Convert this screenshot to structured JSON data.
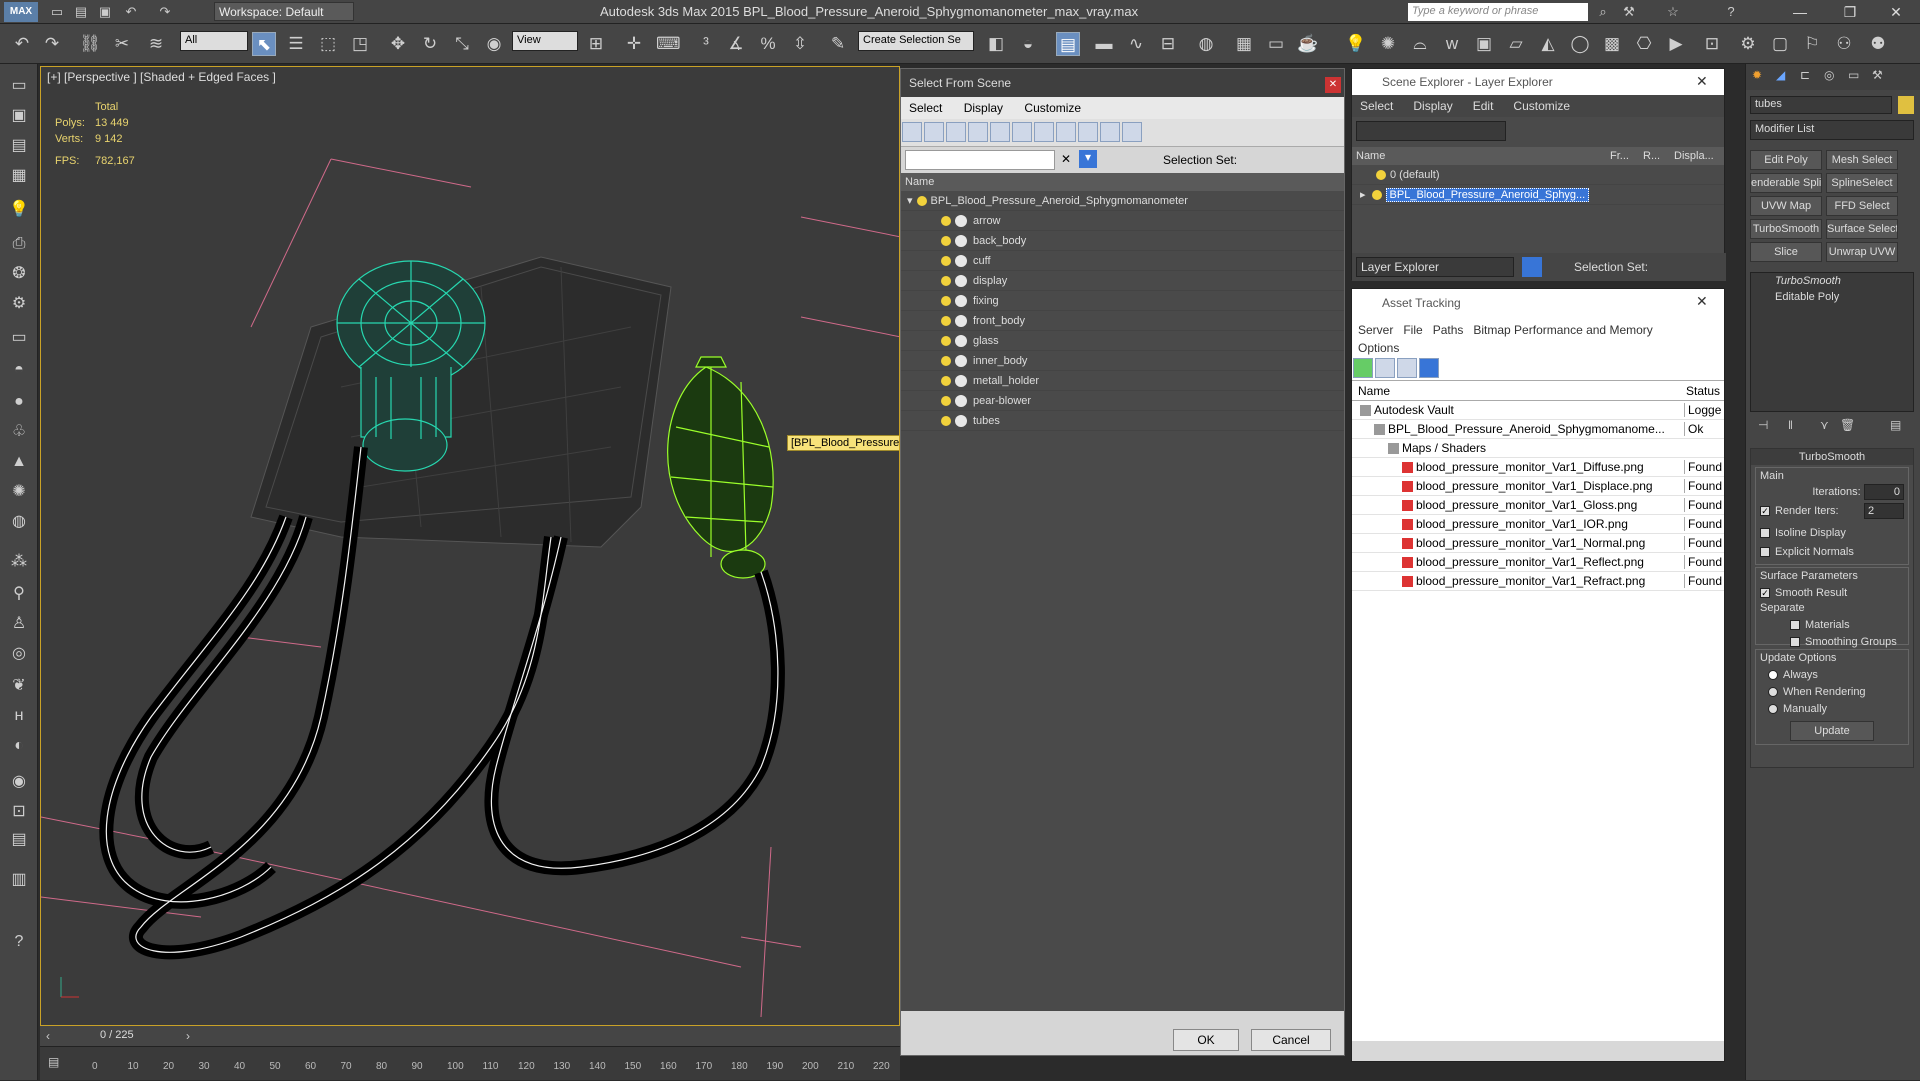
{
  "app": {
    "title": "Autodesk 3ds Max  2015     BPL_Blood_Pressure_Aneroid_Sphygmomanometer_max_vray.max",
    "workspace": "Workspace: Default",
    "search_placeholder": "Type a keyword or phrase"
  },
  "toolbar": {
    "selection_filter": "All",
    "ref_coord": "View",
    "named_selection": "Create Selection Se"
  },
  "viewport": {
    "label": "[+] [Perspective ] [Shaded + Edged Faces ]",
    "stats_total": "Total",
    "polys_label": "Polys:",
    "polys_value": "13 449",
    "verts_label": "Verts:",
    "verts_value": "9 142",
    "fps_label": "FPS:",
    "fps_value": "782,167",
    "object_tooltip": "[BPL_Blood_Pressure"
  },
  "timeline": {
    "frame": "0 / 225",
    "ticks": [
      "0",
      "10",
      "20",
      "30",
      "40",
      "50",
      "60",
      "70",
      "80",
      "90",
      "100",
      "110",
      "120",
      "130",
      "140",
      "150",
      "160",
      "170",
      "180",
      "190",
      "200",
      "210",
      "220"
    ]
  },
  "select_from_scene": {
    "title": "Select From Scene",
    "menu": [
      "Select",
      "Display",
      "Customize"
    ],
    "selection_set_label": "Selection Set:",
    "column_name": "Name",
    "root": "BPL_Blood_Pressure_Aneroid_Sphygmomanometer",
    "items": [
      "arrow",
      "back_body",
      "cuff",
      "display",
      "fixing",
      "front_body",
      "glass",
      "inner_body",
      "metall_holder",
      "pear-blower",
      "tubes"
    ],
    "ok": "OK",
    "cancel": "Cancel"
  },
  "scene_explorer": {
    "title": "Scene Explorer - Layer Explorer",
    "menu": [
      "Select",
      "Display",
      "Edit",
      "Customize"
    ],
    "columns": [
      "Name",
      "Fr...",
      "R...",
      "Displa..."
    ],
    "layers": [
      "0 (default)",
      "BPL_Blood_Pressure_Aneroid_Sphyg..."
    ],
    "footer_dropdown": "Layer Explorer",
    "selection_set_label": "Selection Set:"
  },
  "asset_tracking": {
    "title": "Asset Tracking",
    "menu": [
      "Server",
      "File",
      "Paths",
      "Bitmap Performance and Memory",
      "Options"
    ],
    "col_name": "Name",
    "col_status": "Status",
    "rows": [
      {
        "name": "Autodesk Vault",
        "status": "Logge",
        "indent": 0
      },
      {
        "name": "BPL_Blood_Pressure_Aneroid_Sphygmomanome...",
        "status": "Ok",
        "indent": 1
      },
      {
        "name": "Maps / Shaders",
        "status": "",
        "indent": 2
      },
      {
        "name": "blood_pressure_monitor_Var1_Diffuse.png",
        "status": "Found",
        "indent": 3
      },
      {
        "name": "blood_pressure_monitor_Var1_Displace.png",
        "status": "Found",
        "indent": 3
      },
      {
        "name": "blood_pressure_monitor_Var1_Gloss.png",
        "status": "Found",
        "indent": 3
      },
      {
        "name": "blood_pressure_monitor_Var1_IOR.png",
        "status": "Found",
        "indent": 3
      },
      {
        "name": "blood_pressure_monitor_Var1_Normal.png",
        "status": "Found",
        "indent": 3
      },
      {
        "name": "blood_pressure_monitor_Var1_Reflect.png",
        "status": "Found",
        "indent": 3
      },
      {
        "name": "blood_pressure_monitor_Var1_Refract.png",
        "status": "Found",
        "indent": 3
      }
    ]
  },
  "command_panel": {
    "object_name": "tubes",
    "modifier_list": "Modifier List",
    "buttons": [
      "Edit Poly",
      "Mesh Select",
      "enderable Splir",
      "SplineSelect",
      "UVW Map",
      "FFD Select",
      "TurboSmooth",
      "Surface Select",
      "Slice",
      "Unwrap UVW"
    ],
    "stack": [
      "TurboSmooth",
      "Editable Poly"
    ],
    "turbosmooth": {
      "title": "TurboSmooth",
      "main": "Main",
      "iterations_label": "Iterations:",
      "iterations": "0",
      "render_iters_label": "Render Iters:",
      "render_iters": "2",
      "isoline": "Isoline Display",
      "explicit": "Explicit Normals",
      "surface": "Surface Parameters",
      "smooth": "Smooth Result",
      "separate": "Separate",
      "materials": "Materials",
      "smoothing": "Smoothing Groups",
      "update_options": "Update Options",
      "always": "Always",
      "when_rendering": "When Rendering",
      "manually": "Manually",
      "update": "Update"
    }
  },
  "colors": {
    "accent": "#6a8fc0",
    "selection": "#3875d7",
    "viewport_border": "#c9a227",
    "mesh_selected": "#27d8b0",
    "mesh_green": "#9bff2a"
  }
}
